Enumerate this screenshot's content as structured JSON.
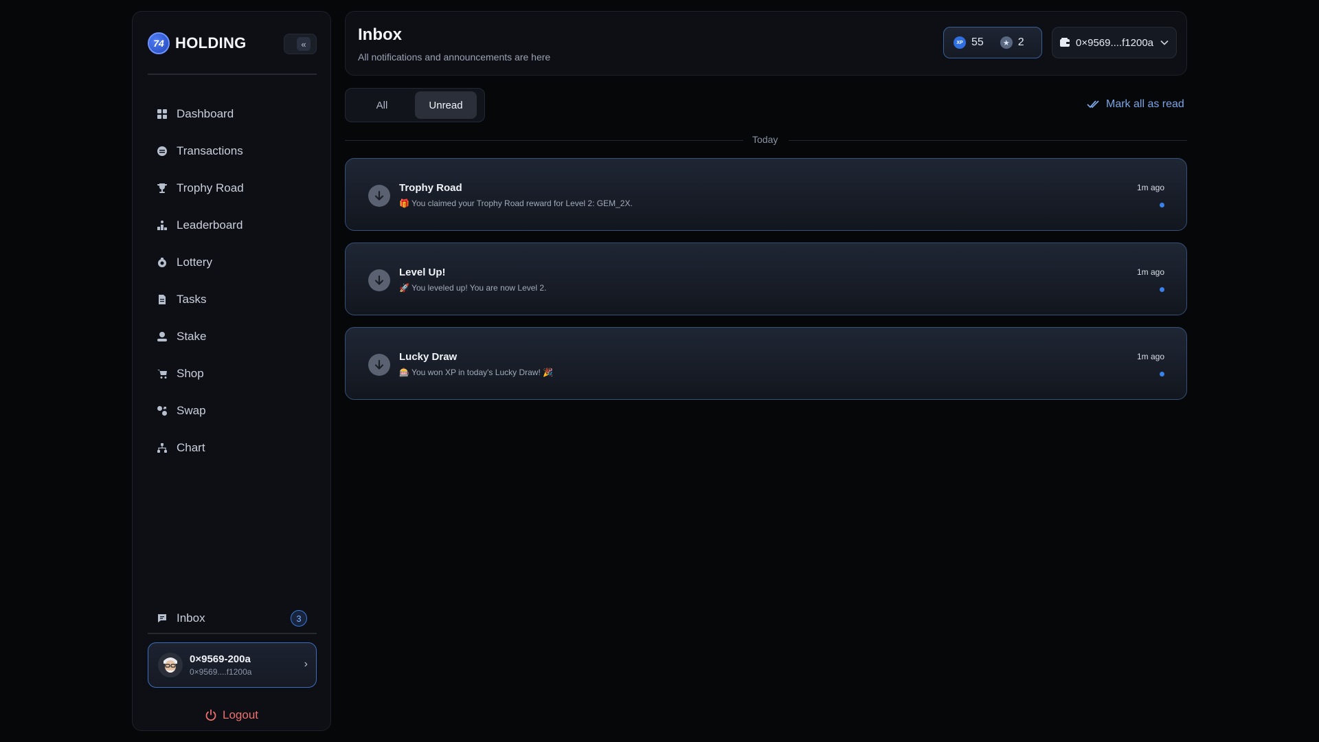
{
  "brand": {
    "name": "HOLDING",
    "logo_text": "74"
  },
  "sidebar": {
    "collapse_icon": "«",
    "items": [
      {
        "label": "Dashboard",
        "icon": "grid-icon"
      },
      {
        "label": "Transactions",
        "icon": "coin-icon"
      },
      {
        "label": "Trophy Road",
        "icon": "trophy-icon"
      },
      {
        "label": "Leaderboard",
        "icon": "podium-icon"
      },
      {
        "label": "Lottery",
        "icon": "lottery-icon"
      },
      {
        "label": "Tasks",
        "icon": "document-icon"
      },
      {
        "label": "Stake",
        "icon": "stake-icon"
      },
      {
        "label": "Shop",
        "icon": "cart-icon"
      },
      {
        "label": "Swap",
        "icon": "swap-icon"
      },
      {
        "label": "Chart",
        "icon": "network-icon"
      }
    ],
    "inbox": {
      "label": "Inbox",
      "badge": "3"
    },
    "profile": {
      "name": "0×9569-200a",
      "address": "0×9569....f1200a"
    },
    "logout_label": "Logout"
  },
  "header": {
    "title": "Inbox",
    "subtitle": "All notifications and announcements are here",
    "xp_badge": "XP",
    "xp_value": "55",
    "star_value": "2",
    "wallet_address": "0×9569....f1200a"
  },
  "tabs": {
    "all": "All",
    "unread": "Unread"
  },
  "mark_all_label": "Mark all as read",
  "day_label": "Today",
  "notifications": [
    {
      "title": "Trophy Road",
      "message": "🎁 You claimed your Trophy Road reward for Level 2: GEM_2X.",
      "time": "1m ago"
    },
    {
      "title": "Level Up!",
      "message": "🚀 You leveled up! You are now Level 2.",
      "time": "1m ago"
    },
    {
      "title": "Lucky Draw",
      "message": "🎰 You won XP in today's Lucky Draw! 🎉",
      "time": "1m ago"
    }
  ],
  "colors": {
    "accent": "#3a82ea",
    "logout": "#ef6f6f",
    "link": "#7aa6e6",
    "background": "#060709"
  }
}
